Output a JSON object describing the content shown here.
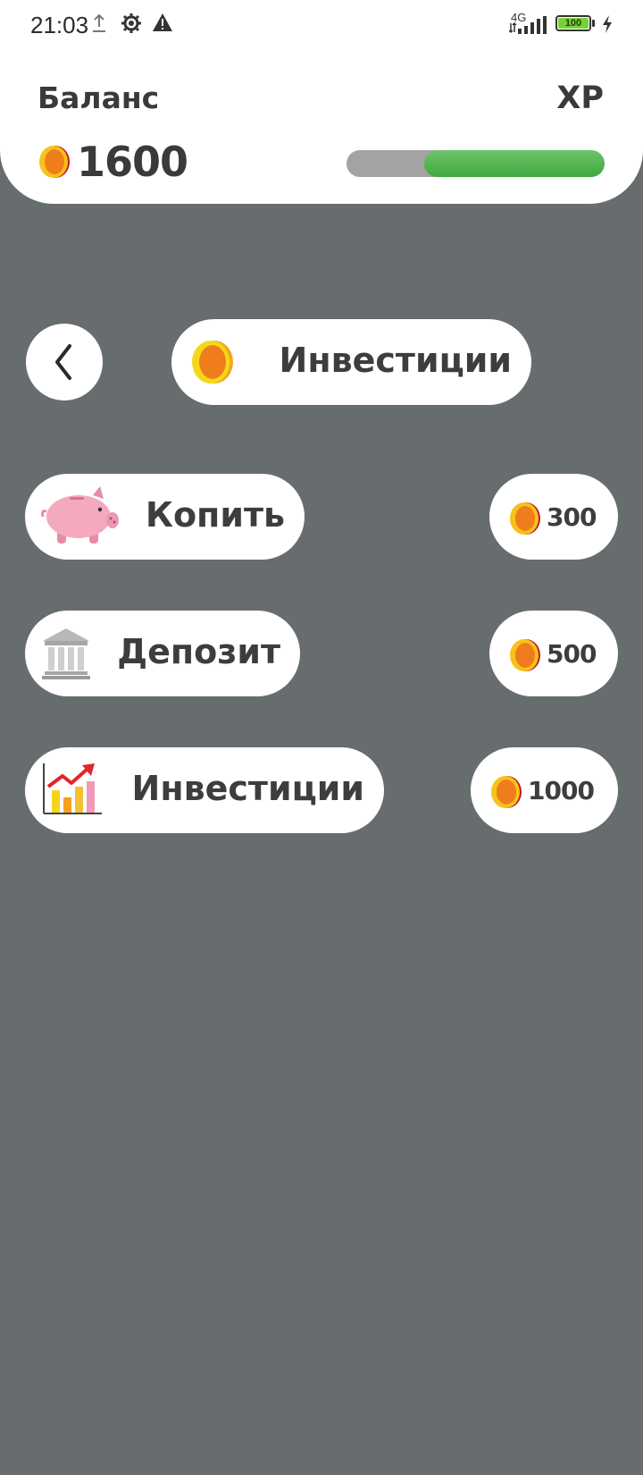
{
  "status_bar": {
    "time": "21:03",
    "network": "4G",
    "battery": "100",
    "icons": [
      "upload-icon",
      "settings-icon",
      "warning-icon",
      "signal-icon",
      "battery-icon",
      "charging-icon"
    ]
  },
  "header": {
    "balance_label": "Баланс",
    "balance_value": "1600",
    "xp_label": "XP",
    "xp_progress": 0.7
  },
  "page": {
    "title": "Инвестиции",
    "back_icon": "chevron-left-icon"
  },
  "options": [
    {
      "label": "Копить",
      "icon": "piggy-bank-icon",
      "price": "300"
    },
    {
      "label": "Депозит",
      "icon": "bank-icon",
      "price": "500"
    },
    {
      "label": "Инвестиции",
      "icon": "growth-chart-icon",
      "price": "1000"
    }
  ],
  "colors": {
    "background": "#676d6e",
    "card": "#ffffff",
    "text": "#3d3d3d",
    "coin_outer": "#f6c21b",
    "coin_inner": "#f07d1c",
    "xp_track": "#a3a3a3",
    "xp_fill": "#4caf50"
  }
}
